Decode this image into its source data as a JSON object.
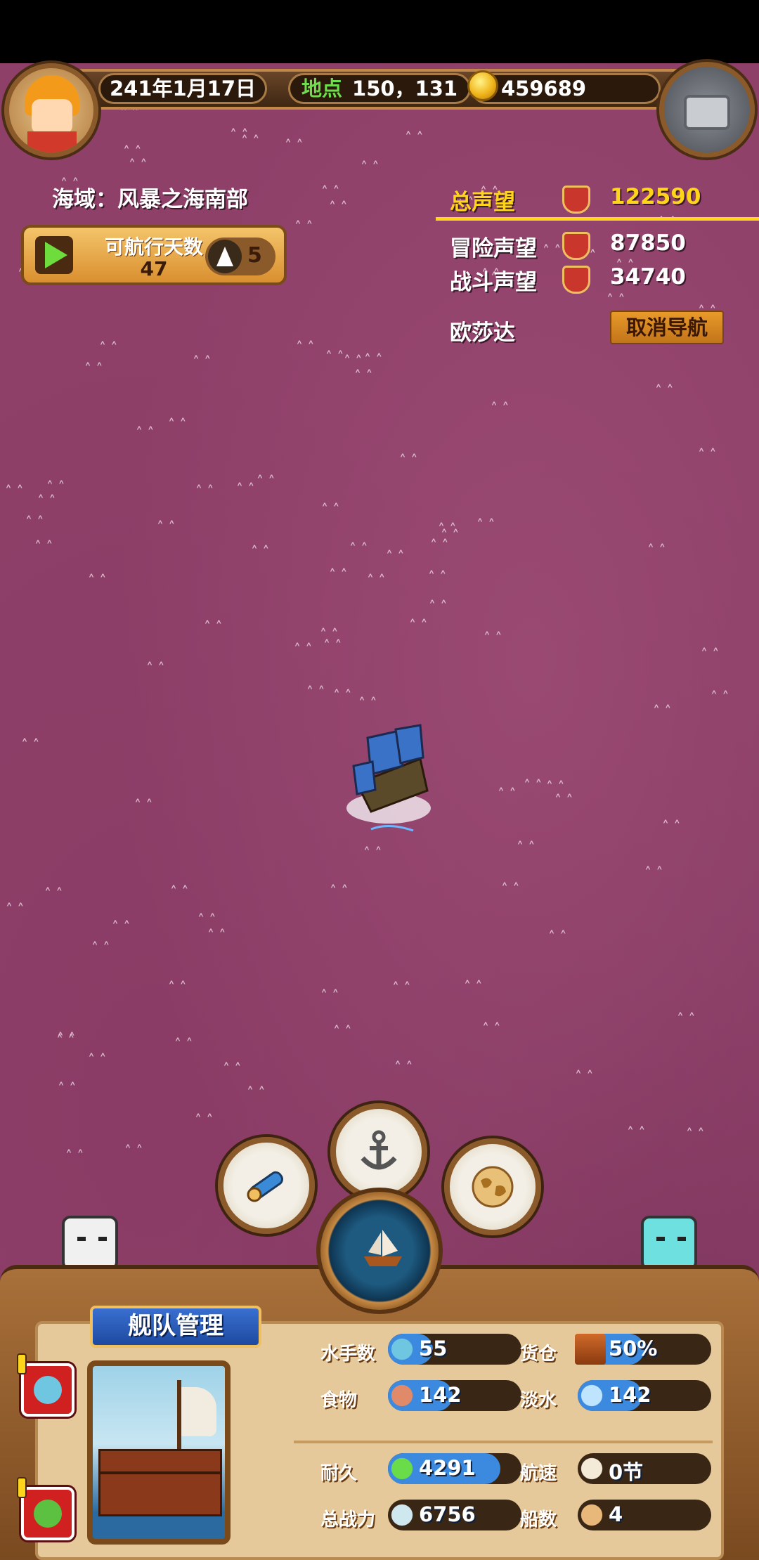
{
  "top_bar": {
    "date": "241年1月17日",
    "location_label": "地点",
    "location_value": "150，131",
    "gold": "459689"
  },
  "sea_region": "海域：风暴之海南部",
  "sailing": {
    "days_label": "可航行天数",
    "days_value": "47",
    "speed_value": "5"
  },
  "reputation": {
    "total_label": "总声望",
    "total_value": "122590",
    "adventure_label": "冒险声望",
    "adventure_value": "87850",
    "battle_label": "战斗声望",
    "battle_value": "34740"
  },
  "navigation": {
    "destination": "欧莎达",
    "cancel_label": "取消导航"
  },
  "fleet": {
    "title": "舰队管理",
    "stats": {
      "sailors_label": "水手数",
      "sailors_value": "55",
      "cargo_label": "货仓",
      "cargo_value": "50%",
      "food_label": "食物",
      "food_value": "142",
      "water_label": "淡水",
      "water_value": "142",
      "durability_label": "耐久",
      "durability_value": "4291",
      "speed_label": "航速",
      "speed_value": "0节",
      "power_label": "总战力",
      "power_value": "6756",
      "ships_label": "船数",
      "ships_value": "4"
    }
  },
  "icons": {
    "telescope": "telescope-icon",
    "anchor": "anchor-icon",
    "map": "world-map-icon",
    "helm": "ship-wheel-icon"
  },
  "colors": {
    "sea": "#8e4069",
    "gold_text": "#ffd51c",
    "green_label": "#6edc4c",
    "bar_fill": "#3c8ae0"
  }
}
